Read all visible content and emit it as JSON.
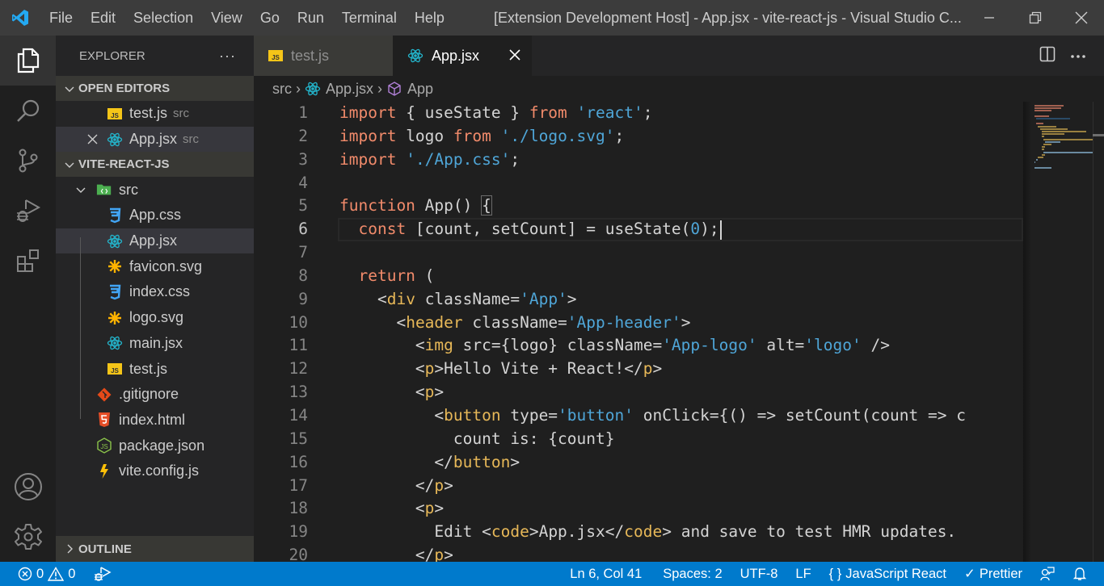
{
  "titlebar": {
    "menu": [
      "File",
      "Edit",
      "Selection",
      "View",
      "Go",
      "Run",
      "Terminal",
      "Help"
    ],
    "window_title": "[Extension Development Host] - App.jsx - vite-react-js - Visual Studio C..."
  },
  "sidebar": {
    "title": "EXPLORER",
    "more": "···",
    "open_editors": {
      "label": "OPEN EDITORS",
      "items": [
        {
          "name": "test.js",
          "desc": "src",
          "icon": "js-file-icon"
        },
        {
          "name": "App.jsx",
          "desc": "src",
          "icon": "react-icon"
        }
      ]
    },
    "project": {
      "label": "VITE-REACT-JS",
      "folder": "src",
      "src_items": [
        {
          "name": "App.css",
          "icon": "css-file-icon"
        },
        {
          "name": "App.jsx",
          "icon": "react-icon"
        },
        {
          "name": "favicon.svg",
          "icon": "svg-file-icon"
        },
        {
          "name": "index.css",
          "icon": "css-file-icon"
        },
        {
          "name": "logo.svg",
          "icon": "svg-file-icon"
        },
        {
          "name": "main.jsx",
          "icon": "react-icon"
        },
        {
          "name": "test.js",
          "icon": "js-file-icon"
        }
      ],
      "root_items": [
        {
          "name": ".gitignore",
          "icon": "git-icon"
        },
        {
          "name": "index.html",
          "icon": "html-file-icon"
        },
        {
          "name": "package.json",
          "icon": "nodejs-icon"
        },
        {
          "name": "vite.config.js",
          "icon": "vite-icon"
        }
      ]
    },
    "outline_label": "OUTLINE"
  },
  "tabs": [
    {
      "label": "test.js",
      "active": false
    },
    {
      "label": "App.jsx",
      "active": true
    }
  ],
  "breadcrumbs": [
    "src",
    "App.jsx",
    "App"
  ],
  "code": {
    "current_line": 6,
    "lines": [
      "import { useState } from 'react';",
      "import logo from './logo.svg';",
      "import './App.css';",
      "",
      "function App() {",
      "  const [count, setCount] = useState(0);",
      "",
      "  return (",
      "    <div className='App'>",
      "      <header className='App-header'>",
      "        <img src={logo} className='App-logo' alt='logo' />",
      "        <p>Hello Vite + React!</p>",
      "        <p>",
      "          <button type='button' onClick={() => setCount(count => c",
      "            count is: {count}",
      "          </button>",
      "        </p>",
      "        <p>",
      "          Edit <code>App.jsx</code> and save to test HMR updates.",
      "        </p>"
    ]
  },
  "statusbar": {
    "errors": "0",
    "warnings": "0",
    "cursor_pos": "Ln 6, Col 41",
    "indent": "Spaces: 2",
    "encoding": "UTF-8",
    "eol": "LF",
    "language": "JavaScript React",
    "formatter": "Prettier"
  },
  "colors": {
    "accent": "#007acc",
    "keyword": "#f28b6b",
    "string": "#4fa6d8",
    "tag": "#e7b858"
  }
}
